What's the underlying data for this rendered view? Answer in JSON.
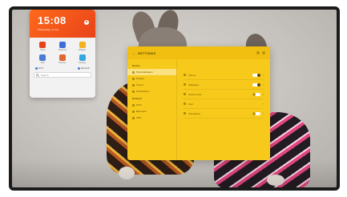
{
  "widget": {
    "time": "15:08",
    "date": "Wednesday, 14 Jun",
    "close_label": "×",
    "tiles": [
      {
        "label": "Notes",
        "color": "#e8431a",
        "icon": "notes-icon"
      },
      {
        "label": "Shortcuts",
        "color": "#3e6fd8",
        "icon": "shortcuts-icon"
      },
      {
        "label": "Widgets",
        "color": "#f2b21b",
        "icon": "widgets-icon"
      },
      {
        "label": "Mail",
        "color": "#4a7bd6",
        "icon": "mail-icon"
      },
      {
        "label": "Browser",
        "color": "#e0662c",
        "icon": "browser-icon"
      },
      {
        "label": "Settings",
        "color": "#3aa8e0",
        "icon": "gear-icon"
      }
    ],
    "chips": [
      "Wi-Fi",
      "Bluetooth"
    ],
    "search_placeholder": "Search"
  },
  "settings": {
    "title": "SETTINGS",
    "sections": [
      {
        "heading": "Device",
        "items": [
          "Personalization",
          "Display",
          "Sound",
          "Notifications"
        ]
      },
      {
        "heading": "Network",
        "items": [
          "Wi-Fi",
          "Bluetooth",
          "VPN"
        ]
      }
    ],
    "active_item": "Personalization",
    "options": [
      {
        "label": "Theme",
        "control": "toggle",
        "on": true
      },
      {
        "label": "Wallpaper",
        "control": "toggle",
        "on": true
      },
      {
        "label": "Accent color",
        "control": "toggle",
        "on": false
      },
      {
        "label": "Font",
        "control": "chevron",
        "on": null
      },
      {
        "label": "Animations",
        "control": "toggle",
        "on": false
      }
    ]
  }
}
